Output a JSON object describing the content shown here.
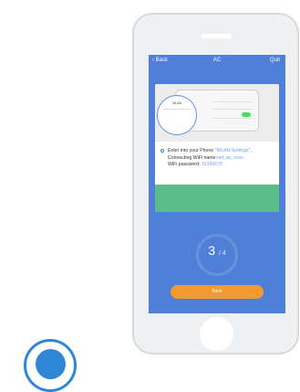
{
  "header": {
    "back_label": "Back",
    "title": "AC",
    "quit_label": "Quit"
  },
  "illustration": {
    "wlan_label": "WLAN"
  },
  "instructions": {
    "line1_prefix": "Enter into your Phone ",
    "line1_highlight": "\"WLAN Settings\"",
    "line1_suffix": ",",
    "line2_label": "Connecting WiFi name:",
    "line2_value": "net_ac_xxxx,",
    "line3_label": "WiFi password:",
    "line3_value": "12345678"
  },
  "progress": {
    "step": "3",
    "total": "/ 4"
  },
  "actions": {
    "next_label": "Next"
  },
  "colors": {
    "screen_bg": "#4f7fd6",
    "accent_orange": "#f39a2e",
    "green_band": "#5bbd8a",
    "link_blue": "#6e9ef2",
    "logo_blue": "#2f86d7"
  }
}
